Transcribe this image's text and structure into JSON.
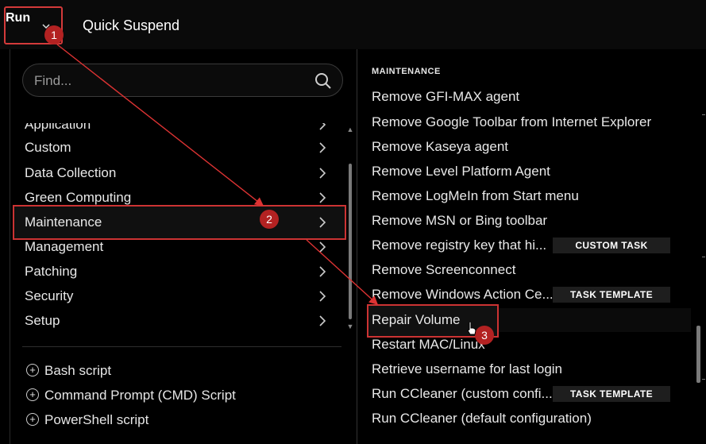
{
  "topbar": {
    "run_label": "Run",
    "quick_suspend": "Quick Suspend"
  },
  "search": {
    "placeholder": "Find..."
  },
  "categories": [
    {
      "label": "Application"
    },
    {
      "label": "Custom"
    },
    {
      "label": "Data Collection"
    },
    {
      "label": "Green Computing"
    },
    {
      "label": "Maintenance"
    },
    {
      "label": "Management"
    },
    {
      "label": "Patching"
    },
    {
      "label": "Security"
    },
    {
      "label": "Setup"
    }
  ],
  "add_scripts": [
    "Bash script",
    "Command Prompt (CMD) Script",
    "PowerShell script"
  ],
  "right": {
    "section_title": "MAINTENANCE",
    "items": [
      {
        "label": "Remove GFI-MAX agent"
      },
      {
        "label": "Remove Google Toolbar from Internet Explorer"
      },
      {
        "label": "Remove Kaseya agent"
      },
      {
        "label": "Remove Level Platform Agent"
      },
      {
        "label": "Remove LogMeIn from Start menu"
      },
      {
        "label": "Remove MSN or Bing toolbar"
      },
      {
        "label": "Remove registry key that hi...",
        "badge": "CUSTOM TASK"
      },
      {
        "label": "Remove Screenconnect"
      },
      {
        "label": "Remove Windows Action Ce...",
        "badge": "TASK TEMPLATE"
      },
      {
        "label": "Repair Volume"
      },
      {
        "label": "Restart MAC/Linux"
      },
      {
        "label": "Retrieve username for last login"
      },
      {
        "label": "Run CCleaner (custom confi...",
        "badge": "TASK TEMPLATE"
      },
      {
        "label": "Run CCleaner (default configuration)"
      }
    ]
  },
  "annotations": [
    "1",
    "2",
    "3"
  ],
  "colors": {
    "highlight": "#cc3333",
    "marker": "#b32222",
    "background": "#000000"
  }
}
